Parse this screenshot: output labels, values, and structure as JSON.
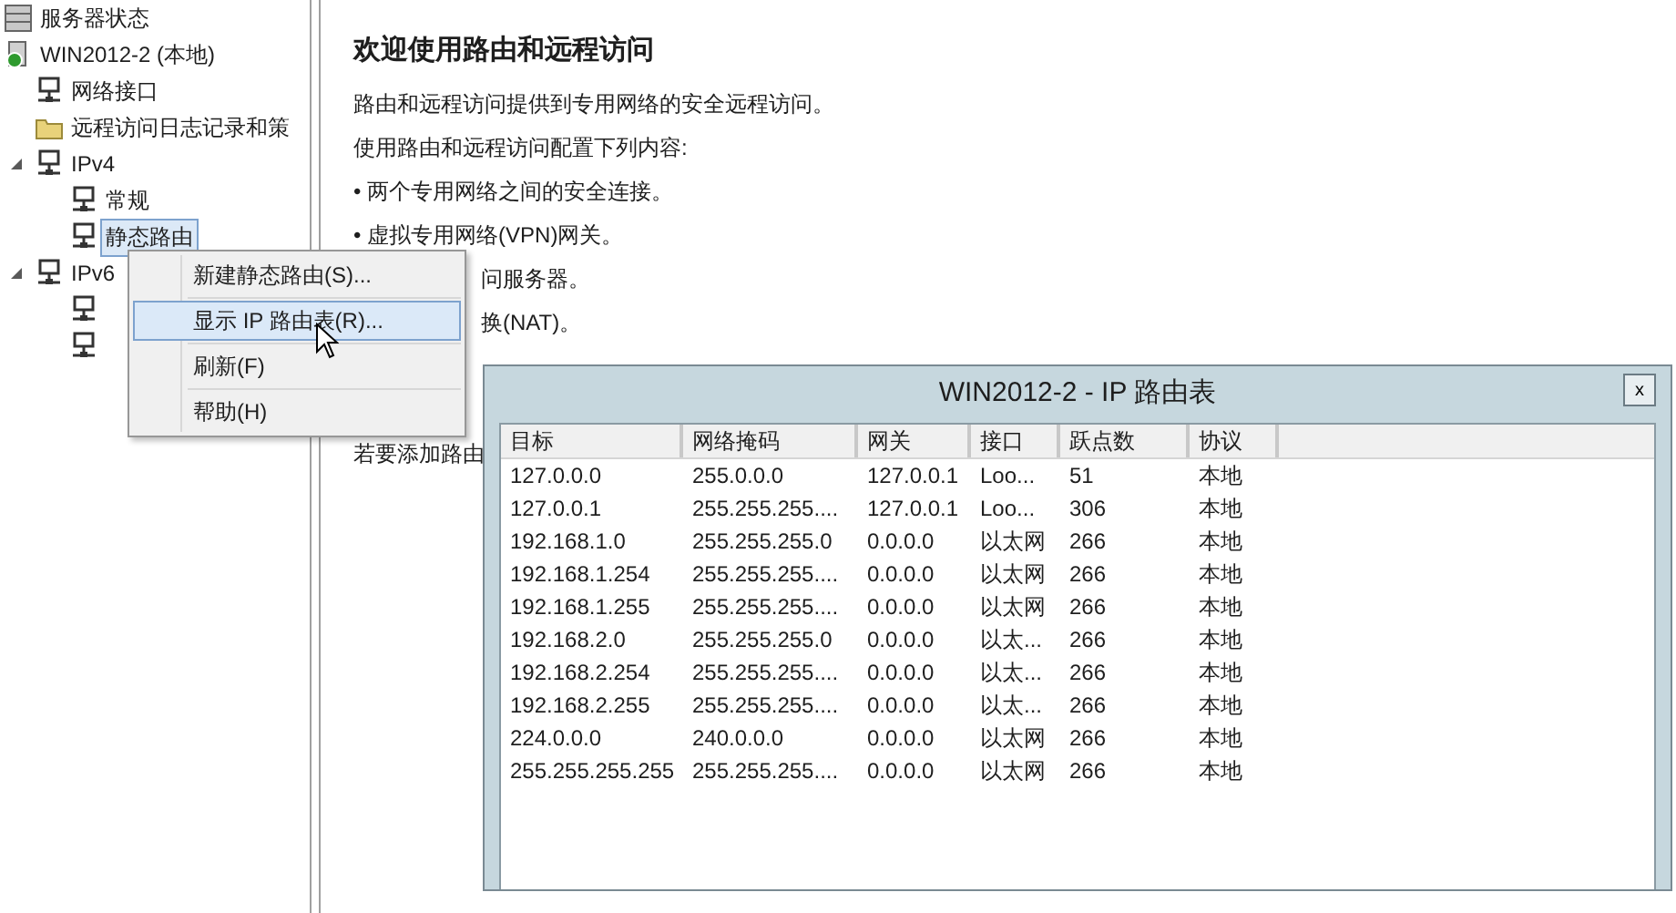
{
  "tree": [
    {
      "label": "服务器状态",
      "kind": "status",
      "selected": false
    },
    {
      "label": "WIN2012-2 (本地)",
      "kind": "server",
      "selected": false,
      "children": [
        {
          "label": "网络接口",
          "kind": "net",
          "selected": false
        },
        {
          "label": "远程访问日志记录和策",
          "kind": "folder",
          "selected": false
        },
        {
          "label": "IPv4",
          "kind": "net",
          "expanded": true,
          "selected": false,
          "children": [
            {
              "label": "常规",
              "kind": "net",
              "selected": false
            },
            {
              "label": "静态路由",
              "kind": "net",
              "selected": true
            }
          ]
        },
        {
          "label": "IPv6",
          "kind": "net",
          "expanded": true,
          "selected": false,
          "children": [
            {
              "kind": "net"
            },
            {
              "kind": "net"
            }
          ]
        }
      ]
    }
  ],
  "content": {
    "heading": "欢迎使用路由和远程访问",
    "lines": [
      {
        "kind": "text",
        "text": "路由和远程访问提供到专用网络的安全远程访问。"
      },
      {
        "kind": "text",
        "text": "使用路由和远程访问配置下列内容:"
      },
      {
        "kind": "text",
        "text": "• 两个专用网络之间的安全连接。"
      },
      {
        "kind": "text",
        "text": "• 虚拟专用网络(VPN)网关。"
      },
      {
        "kind": "partial",
        "text": "问服务器。"
      },
      {
        "kind": "partial",
        "text": "换(NAT)。"
      },
      {
        "kind": "gap"
      },
      {
        "kind": "text",
        "text": "若要添加路由"
      }
    ]
  },
  "context_menu": [
    {
      "label": "新建静态路由(S)...",
      "selected": false
    },
    {
      "label": "显示 IP 路由表(R)...",
      "selected": true
    },
    {
      "label": "刷新(F)",
      "selected": false
    },
    {
      "label": "帮助(H)",
      "selected": false
    }
  ],
  "dialog": {
    "title": "WIN2012-2 - IP 路由表",
    "close": "x",
    "columns": [
      "目标",
      "网络掩码",
      "网关",
      "接口",
      "跃点数",
      "协议"
    ],
    "rows": [
      [
        "127.0.0.0",
        "255.0.0.0",
        "127.0.0.1",
        "Loo...",
        "51",
        "本地"
      ],
      [
        "127.0.0.1",
        "255.255.255....",
        "127.0.0.1",
        "Loo...",
        "306",
        "本地"
      ],
      [
        "192.168.1.0",
        "255.255.255.0",
        "0.0.0.0",
        "以太网",
        "266",
        "本地"
      ],
      [
        "192.168.1.254",
        "255.255.255....",
        "0.0.0.0",
        "以太网",
        "266",
        "本地"
      ],
      [
        "192.168.1.255",
        "255.255.255....",
        "0.0.0.0",
        "以太网",
        "266",
        "本地"
      ],
      [
        "192.168.2.0",
        "255.255.255.0",
        "0.0.0.0",
        "以太...",
        "266",
        "本地"
      ],
      [
        "192.168.2.254",
        "255.255.255....",
        "0.0.0.0",
        "以太...",
        "266",
        "本地"
      ],
      [
        "192.168.2.255",
        "255.255.255....",
        "0.0.0.0",
        "以太...",
        "266",
        "本地"
      ],
      [
        "224.0.0.0",
        "240.0.0.0",
        "0.0.0.0",
        "以太网",
        "266",
        "本地"
      ],
      [
        "255.255.255.255",
        "255.255.255....",
        "0.0.0.0",
        "以太网",
        "266",
        "本地"
      ]
    ]
  }
}
